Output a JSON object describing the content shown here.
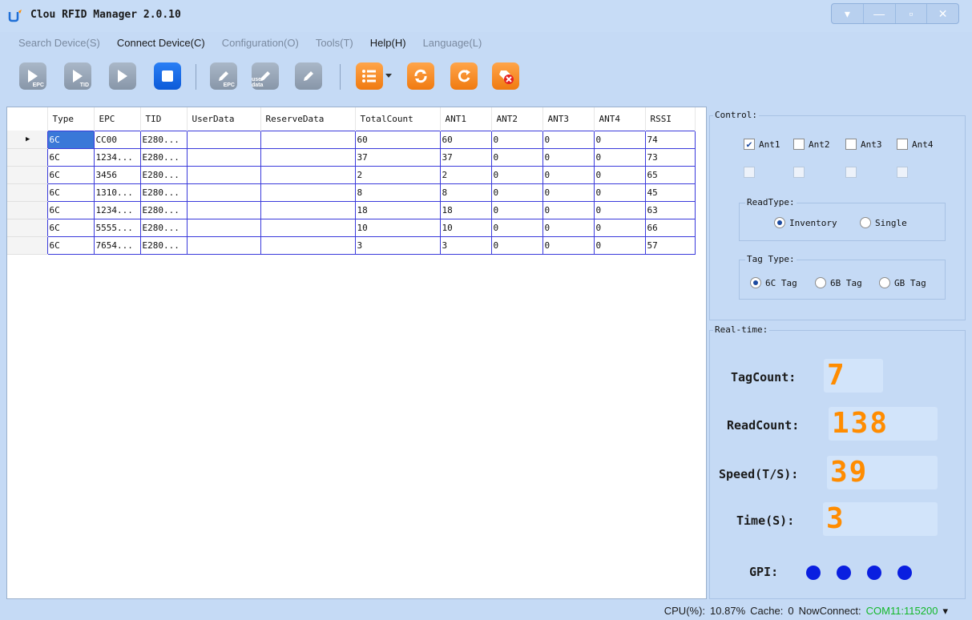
{
  "window": {
    "title": "Clou RFID Manager 2.0.10",
    "controls": [
      "▾",
      "—",
      "▫",
      "✕"
    ]
  },
  "menu": {
    "items": [
      {
        "label": "Search Device(S)",
        "active": false
      },
      {
        "label": "Connect Device(C)",
        "active": true
      },
      {
        "label": "Configuration(O)",
        "active": false
      },
      {
        "label": "Tools(T)",
        "active": false
      },
      {
        "label": "Help(H)",
        "active": true
      },
      {
        "label": "Language(L)",
        "active": false
      }
    ]
  },
  "toolbar": {
    "epc_sub": "EPC",
    "tid_sub": "TID",
    "write_epc_sub": "EPC",
    "user_data_sub": "user data"
  },
  "grid": {
    "columns": [
      "Type",
      "EPC",
      "TID",
      "UserData",
      "ReserveData",
      "TotalCount",
      "ANT1",
      "ANT2",
      "ANT3",
      "ANT4",
      "RSSI"
    ],
    "rows": [
      [
        "6C",
        "CC00",
        "E280...",
        "",
        "",
        "60",
        "60",
        "0",
        "0",
        "0",
        "74"
      ],
      [
        "6C",
        "1234...",
        "E280...",
        "",
        "",
        "37",
        "37",
        "0",
        "0",
        "0",
        "73"
      ],
      [
        "6C",
        "3456",
        "E280...",
        "",
        "",
        "2",
        "2",
        "0",
        "0",
        "0",
        "65"
      ],
      [
        "6C",
        "1310...",
        "E280...",
        "",
        "",
        "8",
        "8",
        "0",
        "0",
        "0",
        "45"
      ],
      [
        "6C",
        "1234...",
        "E280...",
        "",
        "",
        "18",
        "18",
        "0",
        "0",
        "0",
        "63"
      ],
      [
        "6C",
        "5555...",
        "E280...",
        "",
        "",
        "10",
        "10",
        "0",
        "0",
        "0",
        "66"
      ],
      [
        "6C",
        "7654...",
        "E280...",
        "",
        "",
        "3",
        "3",
        "0",
        "0",
        "0",
        "57"
      ]
    ],
    "selected_marker": "▶"
  },
  "control": {
    "title": "Control:",
    "antennas": [
      {
        "label": "Ant1",
        "checked": true
      },
      {
        "label": "Ant2",
        "checked": false
      },
      {
        "label": "Ant3",
        "checked": false
      },
      {
        "label": "Ant4",
        "checked": false
      }
    ],
    "antennas_disabled": 4,
    "read_type": {
      "title": "ReadType:",
      "options": [
        {
          "label": "Inventory",
          "selected": true
        },
        {
          "label": "Single",
          "selected": false
        }
      ]
    },
    "tag_type": {
      "title": "Tag Type:",
      "options": [
        {
          "label": "6C Tag",
          "selected": true
        },
        {
          "label": "6B Tag",
          "selected": false
        },
        {
          "label": "GB Tag",
          "selected": false
        }
      ]
    }
  },
  "realtime": {
    "title": "Real-time:",
    "tag_count_label": "TagCount:",
    "tag_count": "7",
    "read_count_label": "ReadCount:",
    "read_count": "138",
    "speed_label": "Speed(T/S):",
    "speed": "39",
    "time_label": "Time(S):",
    "time": "3",
    "gpi_label": "GPI:",
    "gpi_color": "#0a1fe0"
  },
  "status": {
    "cpu_label": "CPU(%):",
    "cpu_value": "10.87%",
    "cache_label": "Cache:",
    "cache_value": "0",
    "conn_label": "NowConnect:",
    "conn_value": "COM11:115200",
    "dropdown": "▾"
  }
}
